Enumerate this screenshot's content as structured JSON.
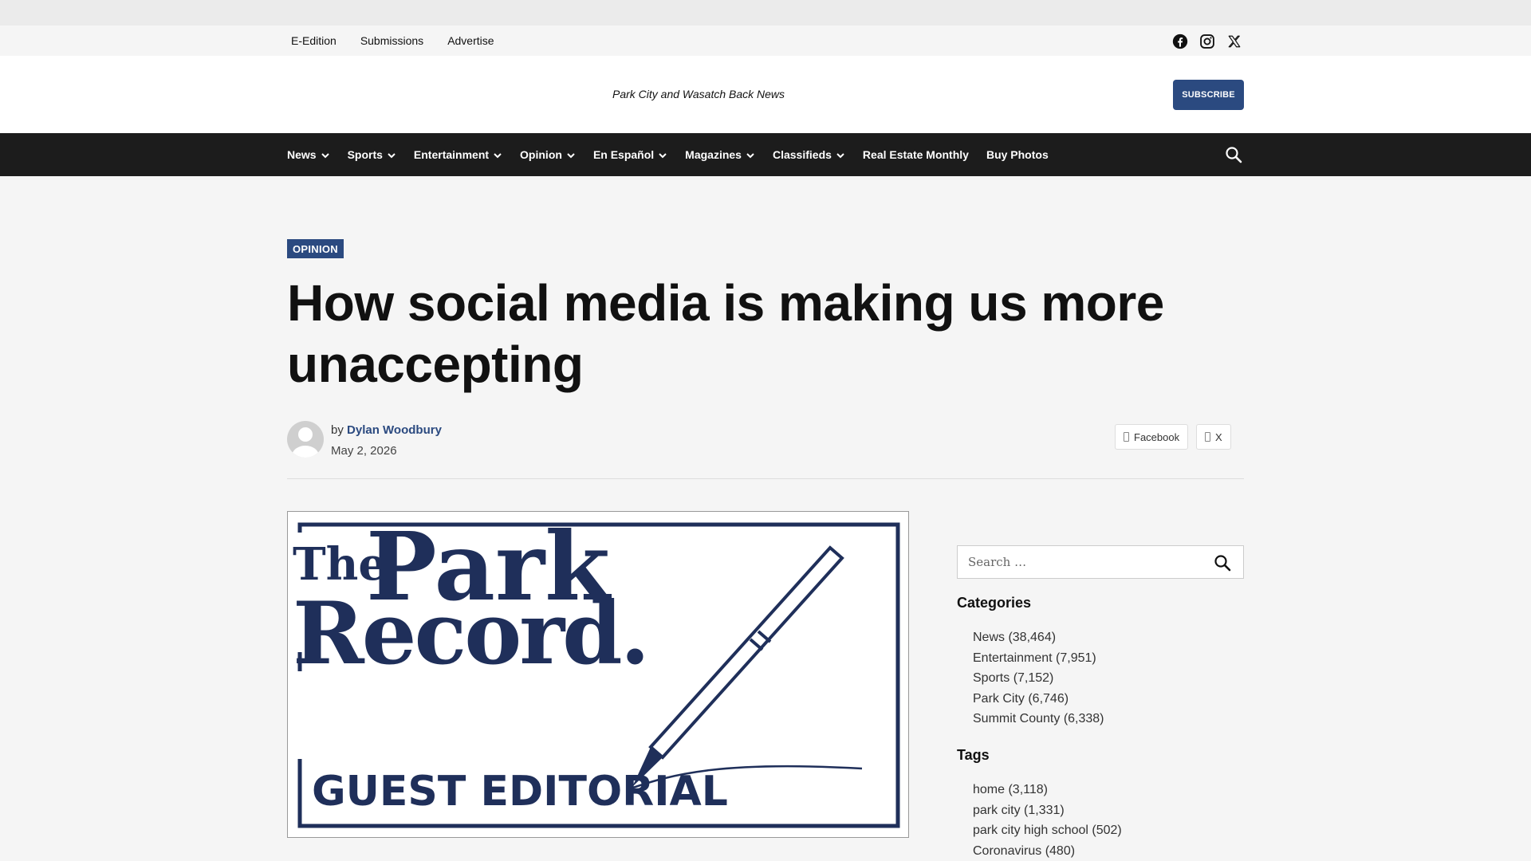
{
  "utility": {
    "links": [
      "E-Edition",
      "Submissions",
      "Advertise"
    ],
    "social": [
      "facebook-icon",
      "instagram-icon",
      "x-icon"
    ]
  },
  "masthead": {
    "tagline": "Park City and Wasatch Back News",
    "subscribe_label": "SUBSCRIBE"
  },
  "nav": {
    "items": [
      {
        "label": "News",
        "dropdown": true
      },
      {
        "label": "Sports",
        "dropdown": true
      },
      {
        "label": "Entertainment",
        "dropdown": true
      },
      {
        "label": "Opinion",
        "dropdown": true
      },
      {
        "label": "En Español",
        "dropdown": true
      },
      {
        "label": "Magazines",
        "dropdown": true
      },
      {
        "label": "Classifieds",
        "dropdown": true
      },
      {
        "label": "Real Estate Monthly",
        "dropdown": false
      },
      {
        "label": "Buy Photos",
        "dropdown": false
      }
    ]
  },
  "article": {
    "category": "OPINION",
    "headline": "How social media is making us more unaccepting",
    "by": "by",
    "author": "Dylan Woodbury",
    "date": "May 2, 2026",
    "share_facebook": "Facebook",
    "share_x": "X"
  },
  "featured": {
    "line1": "The",
    "line2": "Park",
    "line3": "Record.",
    "line4": "GUEST EDITORIAL"
  },
  "sidebar": {
    "search_placeholder": "Search …",
    "categories_title": "Categories",
    "categories": [
      "News (38,464)",
      "Entertainment (7,951)",
      "Sports (7,152)",
      "Park City (6,746)",
      "Summit County (6,338)"
    ],
    "tags_title": "Tags",
    "tags": [
      "home (3,118)",
      "park city (1,331)",
      "park city high school (502)",
      "Coronavirus (480)"
    ]
  },
  "colors": {
    "brand_blue": "#2b4a80",
    "nav_bg": "#1c1c1c",
    "logo_navy": "#1f2f5a"
  }
}
